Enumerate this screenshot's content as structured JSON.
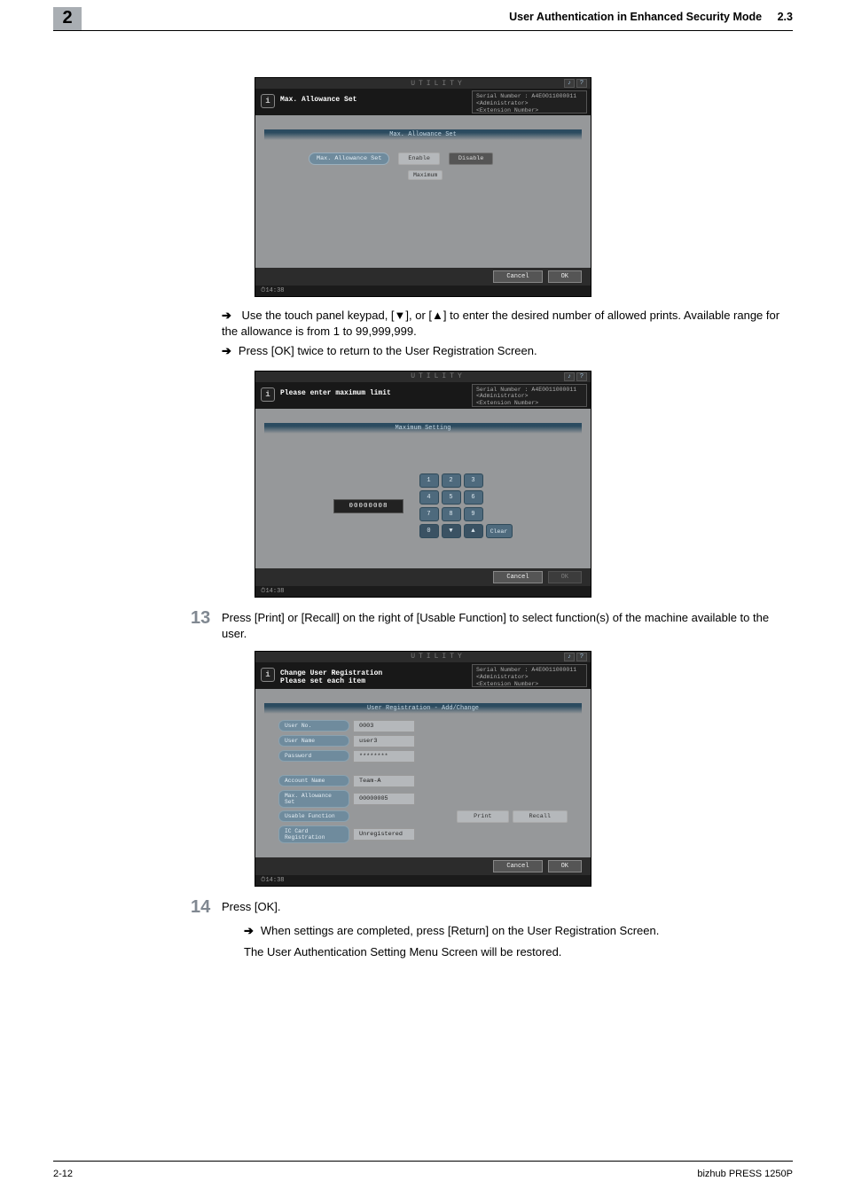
{
  "page": {
    "number": "2",
    "section_number": "2.3",
    "header_title": "User Authentication in Enhanced Security Mode",
    "footer_left": "2-12",
    "footer_right": "bizhub PRESS 1250P"
  },
  "panel_common": {
    "topbar_label": "UTILITY",
    "serial_label": "Serial Number",
    "serial_value": "A4E0011000011",
    "admin_label": "<Administrator>",
    "ext_label": "<Extension Number>",
    "cancel": "Cancel",
    "ok": "OK",
    "time": "14:38",
    "info_i": "i",
    "help": "?",
    "topicon_music_name": "sound-icon"
  },
  "panel1": {
    "title": "Max. Allowance Set",
    "subbar": "Max. Allowance Set",
    "chip": "Max. Allowance Set",
    "enable": "Enable",
    "disable": "Disable",
    "maximum": "Maximum"
  },
  "panel2": {
    "title": "Please enter maximum limit",
    "subbar": "Maximum Setting",
    "value": "00000008",
    "clear": "Clear",
    "keys": {
      "k1": "1",
      "k2": "2",
      "k3": "3",
      "k4": "4",
      "k5": "5",
      "k6": "6",
      "k7": "7",
      "k8": "8",
      "k9": "9",
      "k0": "0",
      "down": "▼",
      "up": "▲"
    }
  },
  "panel3": {
    "title_line1": "Change User Registration",
    "title_line2": "Please set each item",
    "subbar": "User Registration - Add/Change",
    "labels": {
      "user_no": "User No.",
      "user_name": "User Name",
      "password": "Password",
      "account": "Account Name",
      "max_allow": "Max. Allowance Set",
      "usable": "Usable Function",
      "ic": "IC Card Registration"
    },
    "values": {
      "user_no": "0003",
      "user_name": "user3",
      "password": "********",
      "account": "Team-A",
      "max_allow": "00000005",
      "ic": "Unregistered"
    },
    "print": "Print",
    "recall": "Recall"
  },
  "text": {
    "bullet1_prefix": "Use the touch panel keypad, [",
    "bullet1_mid1": "], or [",
    "bullet1_mid2": "] to enter the desired number of allowed prints. Available range for the allowance is from 1 to 99,999,999.",
    "down_tri": "▼",
    "up_tri": "▲",
    "bullet2": "Press [OK] twice to return to the User Registration Screen.",
    "step13_num": "13",
    "step13": "Press [Print] or [Recall] on the right of [Usable Function] to select function(s) of the machine available to the user.",
    "step14_num": "14",
    "step14": "Press [OK].",
    "step14_bullet": "When settings are completed, press [Return] on the User Registration Screen.",
    "step14_line2": "The User Authentication Setting Menu Screen will be restored."
  }
}
